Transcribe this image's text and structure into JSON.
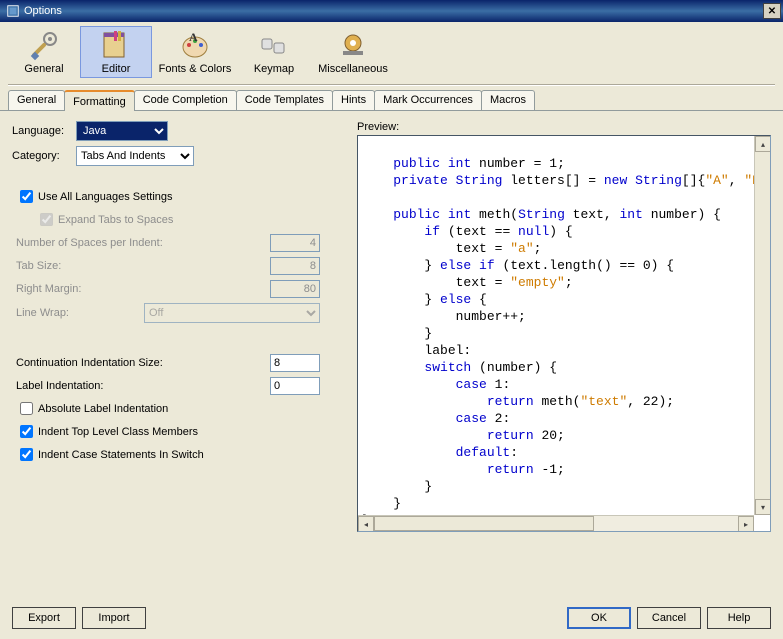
{
  "window": {
    "title": "Options"
  },
  "toolbar": {
    "items": [
      {
        "label": "General"
      },
      {
        "label": "Editor"
      },
      {
        "label": "Fonts & Colors"
      },
      {
        "label": "Keymap"
      },
      {
        "label": "Miscellaneous"
      }
    ]
  },
  "tabs": {
    "items": [
      {
        "label": "General"
      },
      {
        "label": "Formatting"
      },
      {
        "label": "Code Completion"
      },
      {
        "label": "Code Templates"
      },
      {
        "label": "Hints"
      },
      {
        "label": "Mark Occurrences"
      },
      {
        "label": "Macros"
      }
    ]
  },
  "form": {
    "language_label": "Language:",
    "language_value": "Java",
    "category_label": "Category:",
    "category_value": "Tabs And Indents",
    "use_all_lang": "Use All Languages Settings",
    "expand_tabs": "Expand Tabs to Spaces",
    "num_spaces_label": "Number of Spaces per Indent:",
    "num_spaces_value": "4",
    "tab_size_label": "Tab Size:",
    "tab_size_value": "8",
    "right_margin_label": "Right Margin:",
    "right_margin_value": "80",
    "line_wrap_label": "Line Wrap:",
    "line_wrap_value": "Off",
    "cont_indent_label": "Continuation Indentation Size:",
    "cont_indent_value": "8",
    "label_indent_label": "Label Indentation:",
    "label_indent_value": "0",
    "abs_label": "Absolute Label Indentation",
    "indent_top": "Indent Top Level Class Members",
    "indent_case": "Indent Case Statements In Switch"
  },
  "preview": {
    "label": "Preview:",
    "code_lines": [
      "",
      "    public int number = 1;",
      "    private String letters[] = new String[]{\"A\", \"B",
      "",
      "    public int meth(String text, int number) {",
      "        if (text == null) {",
      "            text = \"a\";",
      "        } else if (text.length() == 0) {",
      "            text = \"empty\";",
      "        } else {",
      "            number++;",
      "        }",
      "        label:",
      "        switch (number) {",
      "            case 1:",
      "                return meth(\"text\", 22);",
      "            case 2:",
      "                return 20;",
      "            default:",
      "                return -1;",
      "        }",
      "    }",
      "}"
    ]
  },
  "buttons": {
    "export": "Export",
    "import": "Import",
    "ok": "OK",
    "cancel": "Cancel",
    "help": "Help"
  }
}
